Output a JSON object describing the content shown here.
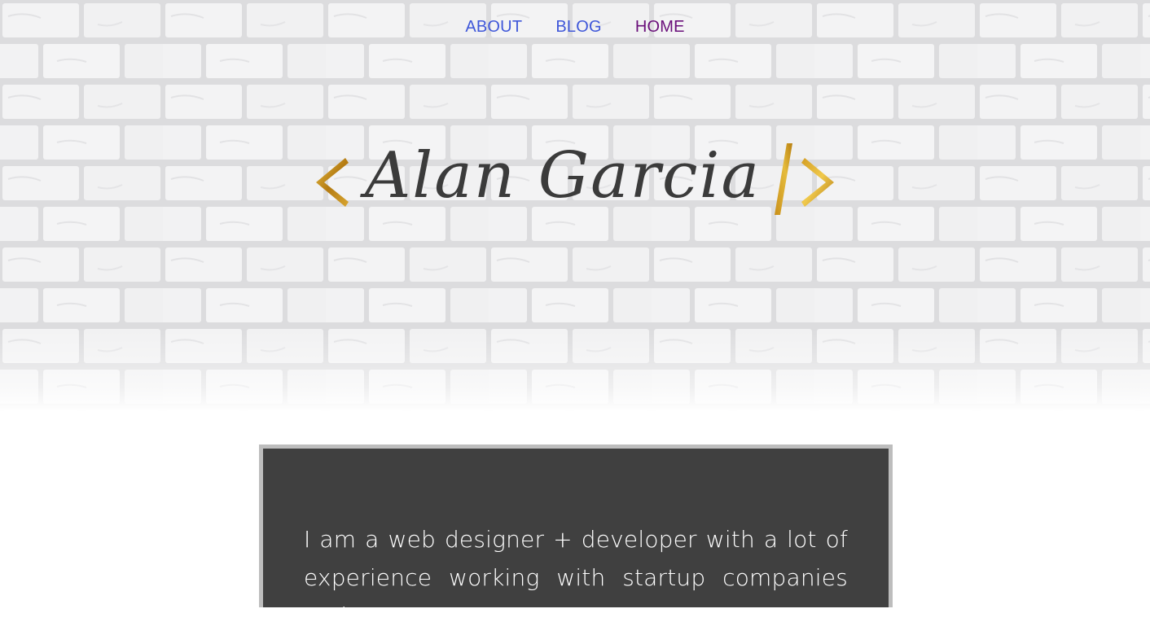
{
  "nav": {
    "items": [
      {
        "label": "ABOUT",
        "state": "link"
      },
      {
        "label": "BLOG",
        "state": "link"
      },
      {
        "label": "HOME",
        "state": "visited"
      }
    ],
    "colors": {
      "link": "#3f57d9",
      "visited": "#6a0f7a"
    }
  },
  "hero": {
    "logo_name": "Alan Garcia",
    "logo_open_bracket": "<",
    "logo_close_slash": "/",
    "logo_close_bracket": ">",
    "logo_accent_color": "#c9961e",
    "background": "white-brick-wall"
  },
  "intro": {
    "lines": [
      "I am a web designer + developer with a lot of",
      "experience working with startup companies and"
    ]
  }
}
